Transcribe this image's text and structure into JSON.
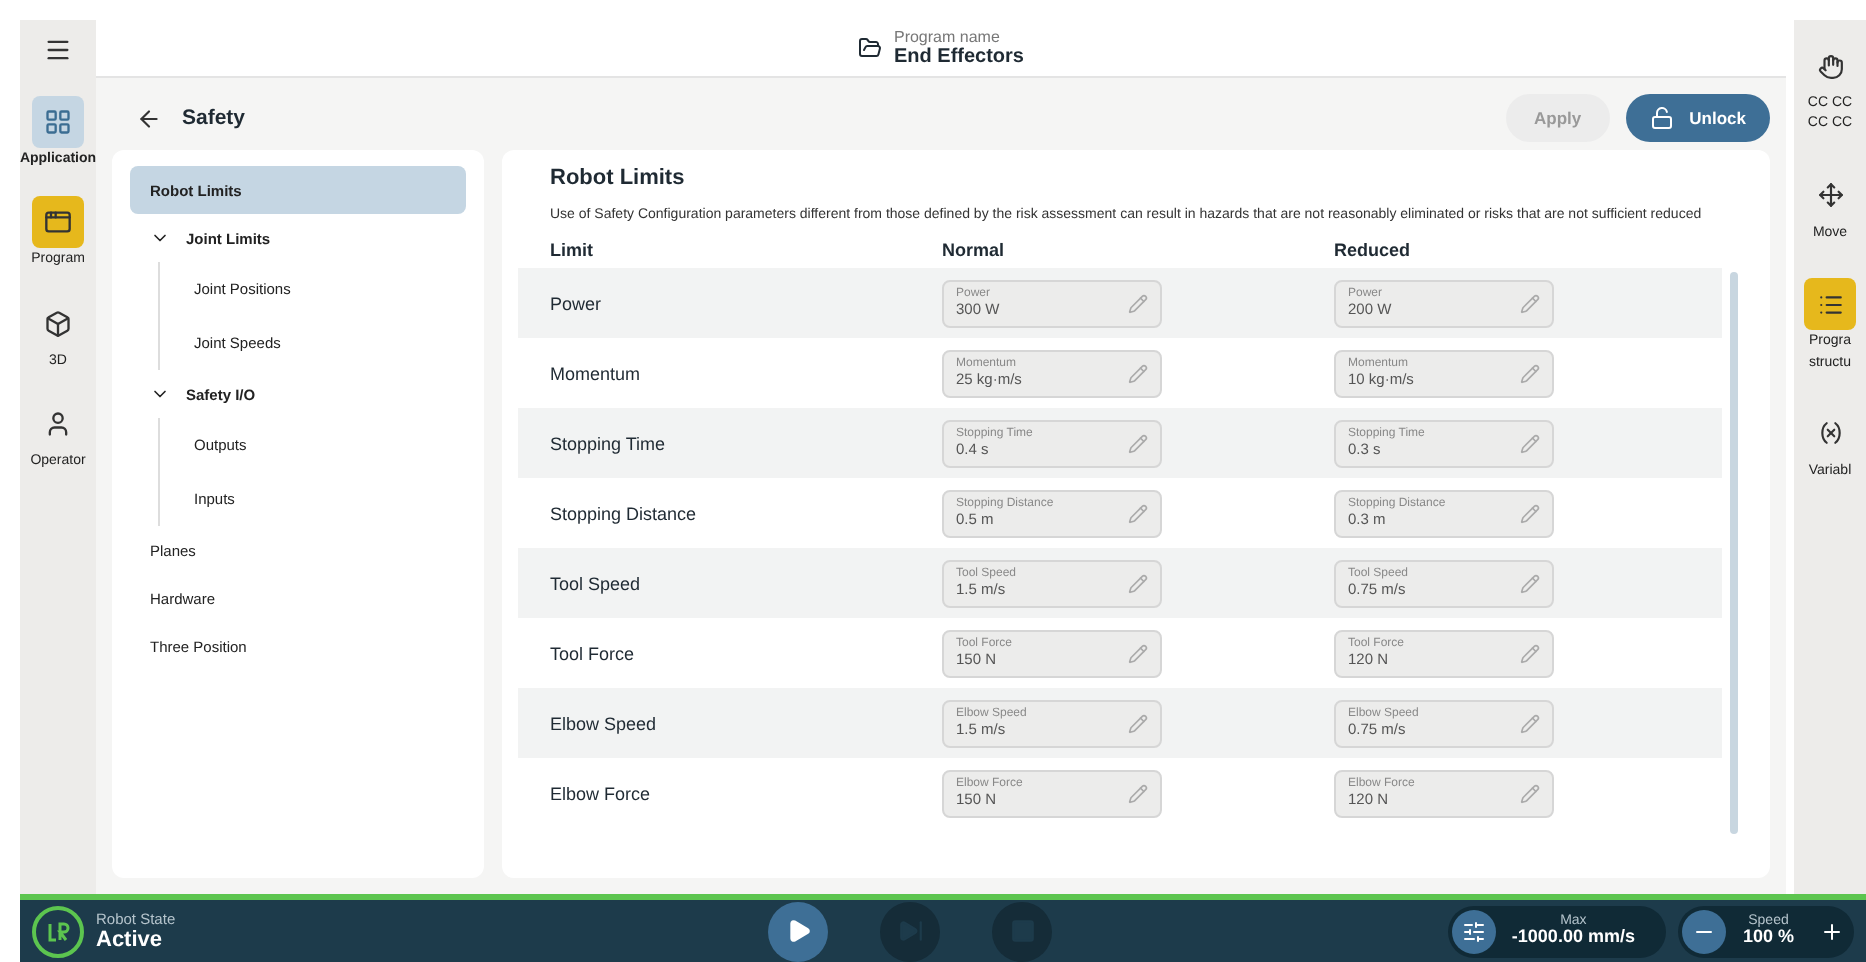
{
  "header": {
    "label": "Program name",
    "title": "End Effectors"
  },
  "left_rail": [
    {
      "kind": "grid",
      "label": "Application",
      "selected": true,
      "flagged": false
    },
    {
      "kind": "program",
      "label": "Program",
      "selected": false,
      "flagged": true
    },
    {
      "kind": "cube",
      "label": "3D",
      "selected": false,
      "flagged": false
    },
    {
      "kind": "user",
      "label": "Operator",
      "selected": false,
      "flagged": false
    }
  ],
  "page": {
    "title": "Safety",
    "buttons": [
      {
        "kind": "apply",
        "label": "Apply",
        "disabled": true
      },
      {
        "kind": "unlock",
        "label": "Unlock",
        "disabled": false
      }
    ]
  },
  "nav": [
    {
      "label": "Robot Limits",
      "selected": true
    },
    {
      "label": "Joint Limits",
      "selected": false,
      "expanded": true,
      "children": [
        {
          "label": "Joint Positions",
          "selected": false
        },
        {
          "label": "Joint Speeds",
          "selected": false
        }
      ]
    },
    {
      "label": "Safety I/O",
      "selected": false,
      "expanded": true,
      "children": [
        {
          "label": "Outputs",
          "selected": false
        },
        {
          "label": "Inputs",
          "selected": false
        }
      ]
    },
    {
      "label": "Planes",
      "selected": false
    },
    {
      "label": "Hardware",
      "selected": false
    },
    {
      "label": "Three Position",
      "selected": false
    }
  ],
  "panel": {
    "title": "Robot Limits",
    "warning": "Use of Safety Configuration parameters different from those defined by the risk assessment can result in hazards that are not reasonably eliminated or risks that are not sufficient reduced",
    "columns": [
      "Limit",
      "Normal",
      "Reduced"
    ],
    "rows": [
      {
        "name": "Power",
        "normal": {
          "label": "Power",
          "value": "300 W"
        },
        "reduced": {
          "label": "Power",
          "value": "200 W"
        }
      },
      {
        "name": "Momentum",
        "normal": {
          "label": "Momentum",
          "value": "25 kg·m/s"
        },
        "reduced": {
          "label": "Momentum",
          "value": "10 kg·m/s"
        }
      },
      {
        "name": "Stopping Time",
        "normal": {
          "label": "Stopping Time",
          "value": "0.4 s"
        },
        "reduced": {
          "label": "Stopping Time",
          "value": "0.3 s"
        }
      },
      {
        "name": "Stopping Distance",
        "normal": {
          "label": "Stopping Distance",
          "value": "0.5 m"
        },
        "reduced": {
          "label": "Stopping Distance",
          "value": "0.3 m"
        }
      },
      {
        "name": "Tool Speed",
        "normal": {
          "label": "Tool Speed",
          "value": "1.5 m/s"
        },
        "reduced": {
          "label": "Tool Speed",
          "value": "0.75 m/s"
        }
      },
      {
        "name": "Tool Force",
        "normal": {
          "label": "Tool Force",
          "value": "150 N"
        },
        "reduced": {
          "label": "Tool Force",
          "value": "120 N"
        }
      },
      {
        "name": "Elbow Speed",
        "normal": {
          "label": "Elbow Speed",
          "value": "1.5 m/s"
        },
        "reduced": {
          "label": "Elbow Speed",
          "value": "0.75 m/s"
        }
      },
      {
        "name": "Elbow Force",
        "normal": {
          "label": "Elbow Force",
          "value": "150 N"
        },
        "reduced": {
          "label": "Elbow Force",
          "value": "120 N"
        }
      }
    ]
  },
  "right_rail": [
    {
      "kind": "hand",
      "lines": [
        "CC CC",
        "CC CC"
      ],
      "flagged": false
    },
    {
      "kind": "move",
      "lines": [
        "Move"
      ],
      "flagged": false
    },
    {
      "kind": "list",
      "lines": [
        "Progra",
        "structu"
      ],
      "flagged": true
    },
    {
      "kind": "variable",
      "lines": [
        "Variabl"
      ],
      "flagged": false
    }
  ],
  "status_bar": {
    "label": "Robot State",
    "state": "Active",
    "controls": [
      {
        "kind": "play",
        "disabled": false
      },
      {
        "kind": "step",
        "disabled": true
      },
      {
        "kind": "stop",
        "disabled": true
      }
    ],
    "max": {
      "label": "Max",
      "value": "-1000.00 mm/s"
    },
    "speed": {
      "label": "Speed",
      "value": "100 %"
    }
  }
}
